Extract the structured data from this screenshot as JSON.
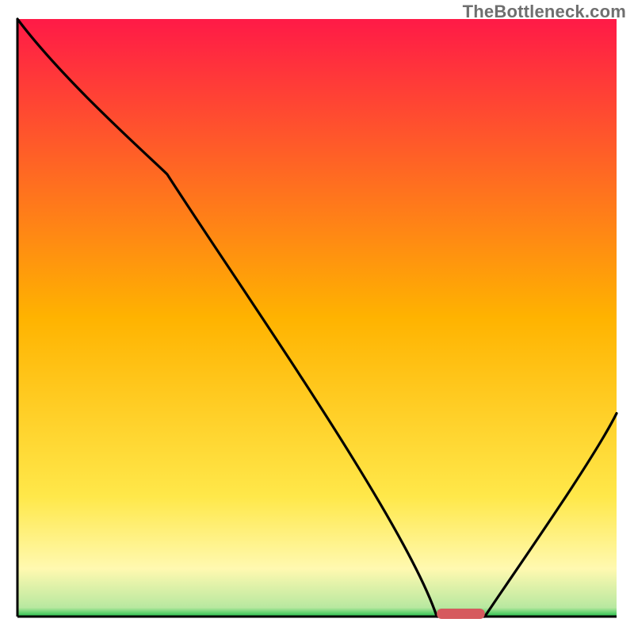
{
  "watermark": "TheBottleneck.com",
  "chart_data": {
    "type": "line",
    "title": "",
    "xlabel": "",
    "ylabel": "",
    "xlim": [
      0,
      100
    ],
    "ylim": [
      0,
      100
    ],
    "grid": false,
    "legend": false,
    "series": [
      {
        "name": "bottleneck-curve",
        "x": [
          0,
          25,
          70,
          78,
          100
        ],
        "y": [
          100,
          74,
          0,
          0,
          34
        ]
      }
    ],
    "marker": {
      "name": "optimal-zone",
      "x_center": 74,
      "width": 8,
      "color": "#d65a5e"
    },
    "background_gradient": {
      "stops": [
        {
          "offset": 0.0,
          "color": "#ff1a47"
        },
        {
          "offset": 0.5,
          "color": "#ffb300"
        },
        {
          "offset": 0.8,
          "color": "#ffe84a"
        },
        {
          "offset": 0.92,
          "color": "#fff9b0"
        },
        {
          "offset": 0.985,
          "color": "#b8e8a0"
        },
        {
          "offset": 1.0,
          "color": "#25c04b"
        }
      ]
    },
    "frame_color": "#000000"
  }
}
